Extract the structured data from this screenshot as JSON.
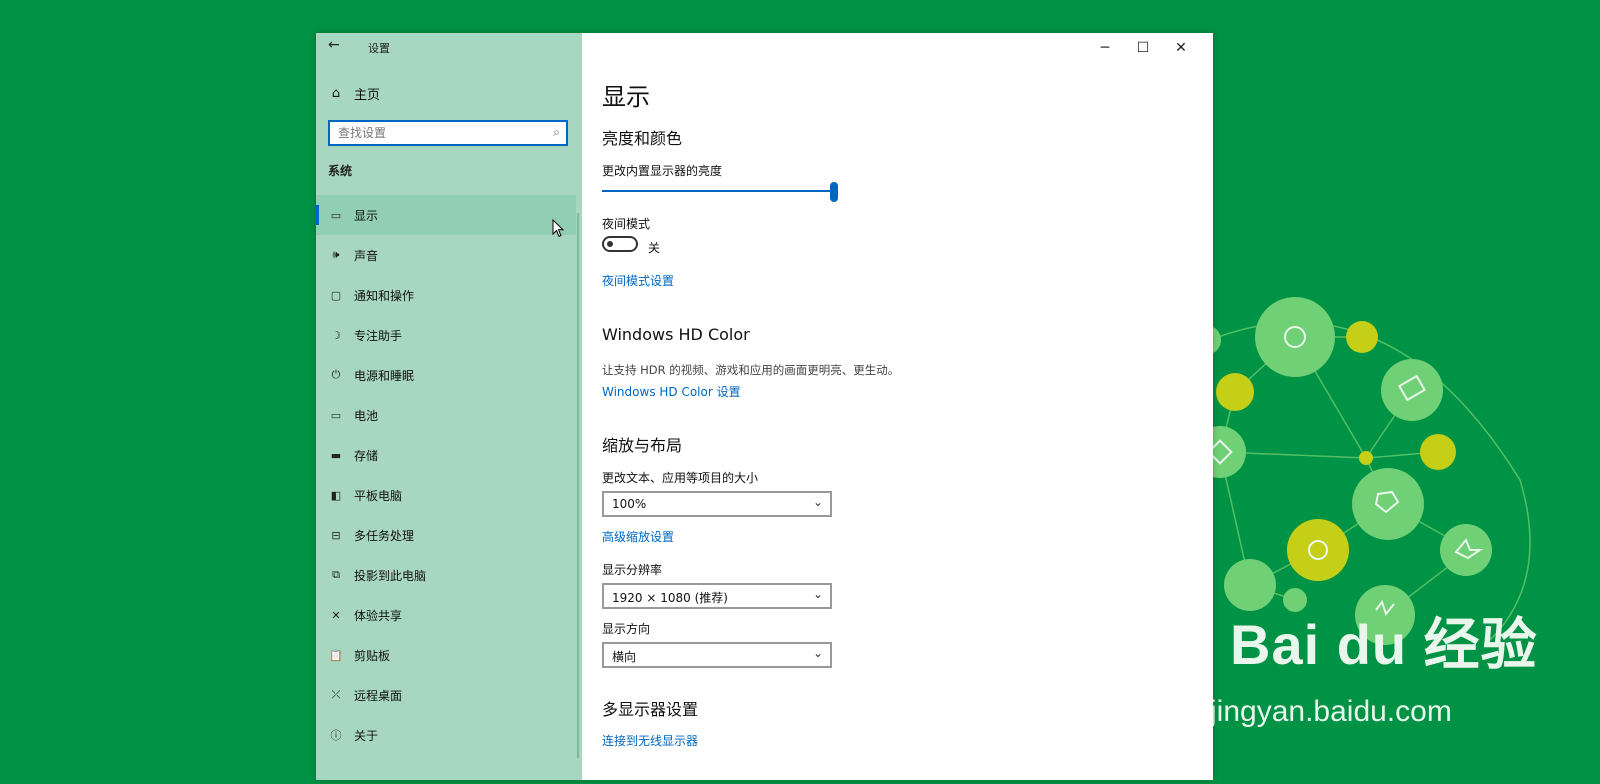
{
  "window": {
    "title": "设置",
    "back_icon": "arrow-left-icon",
    "controls": [
      "minimize-icon",
      "maximize-icon",
      "close-icon"
    ]
  },
  "sidebar": {
    "home_label": "主页",
    "search_placeholder": "查找设置",
    "section_title": "系统",
    "items": [
      {
        "label": "显示",
        "icon": "monitor-icon",
        "active": true
      },
      {
        "label": "声音",
        "icon": "speaker-icon"
      },
      {
        "label": "通知和操作",
        "icon": "message-icon"
      },
      {
        "label": "专注助手",
        "icon": "moon-icon"
      },
      {
        "label": "电源和睡眠",
        "icon": "power-icon"
      },
      {
        "label": "电池",
        "icon": "battery-icon"
      },
      {
        "label": "存储",
        "icon": "storage-icon"
      },
      {
        "label": "平板电脑",
        "icon": "tablet-icon"
      },
      {
        "label": "多任务处理",
        "icon": "multitask-icon"
      },
      {
        "label": "投影到此电脑",
        "icon": "project-icon"
      },
      {
        "label": "体验共享",
        "icon": "share-icon"
      },
      {
        "label": "剪贴板",
        "icon": "clipboard-icon"
      },
      {
        "label": "远程桌面",
        "icon": "remote-icon"
      },
      {
        "label": "关于",
        "icon": "info-icon"
      }
    ]
  },
  "main": {
    "title": "显示",
    "brightness": {
      "heading": "亮度和颜色",
      "label": "更改内置显示器的亮度",
      "level": 1.0
    },
    "night": {
      "label": "夜间模式",
      "state": "关",
      "settings_link": "夜间模式设置"
    },
    "hdr": {
      "heading": "Windows HD Color",
      "description": "让支持 HDR 的视频、游戏和应用的画面更明亮、更生动。",
      "link": "Windows HD Color 设置"
    },
    "scale": {
      "heading": "缩放与布局",
      "size_label": "更改文本、应用等项目的大小",
      "size_value": "100%",
      "advanced_link": "高级缩放设置",
      "resolution_label": "显示分辨率",
      "resolution_value": "1920 × 1080 (推荐)",
      "orientation_label": "显示方向",
      "orientation_value": "横向"
    },
    "multi": {
      "heading": "多显示器设置",
      "link": "连接到无线显示器"
    }
  },
  "watermark": {
    "brand": "Bai du 经验",
    "url": "jingyan.baidu.com"
  },
  "colors": {
    "background": "#009245",
    "sidebar": "#a7d7c0",
    "accent": "#0067c0"
  }
}
